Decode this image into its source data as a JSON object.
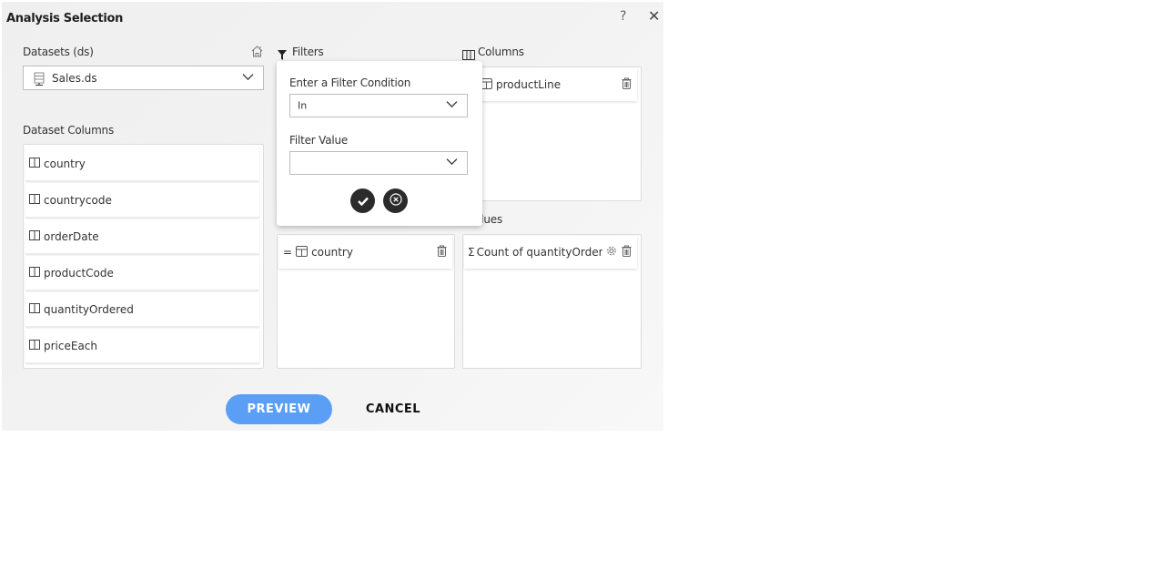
{
  "dialog": {
    "title": "Analysis Selection",
    "help_label": "?",
    "close_label": "✕"
  },
  "datasets": {
    "label": "Datasets (ds)",
    "selected": "Sales.ds"
  },
  "dataset_columns": {
    "label": "Dataset Columns",
    "items": [
      {
        "label": "country"
      },
      {
        "label": "countrycode"
      },
      {
        "label": "orderDate"
      },
      {
        "label": "productCode"
      },
      {
        "label": "quantityOrdered"
      },
      {
        "label": "priceEach"
      }
    ]
  },
  "filters": {
    "label": "Filters",
    "items": [
      {
        "prefix": "=",
        "label": "country"
      }
    ]
  },
  "filter_popup": {
    "condition_label": "Enter a Filter Condition",
    "condition_value": "In",
    "value_label": "Filter Value",
    "value_value": ""
  },
  "columns": {
    "label": "Columns",
    "items": [
      {
        "label": "productLine"
      }
    ]
  },
  "values": {
    "label": "Values",
    "items": [
      {
        "prefix": "Σ",
        "label": "Count of quantityOrdered"
      }
    ]
  },
  "actions": {
    "preview_label": "PREVIEW",
    "cancel_label": "CANCEL"
  },
  "colors": {
    "accent": "#5a9ef5",
    "dark_button": "#2b2b2b"
  }
}
